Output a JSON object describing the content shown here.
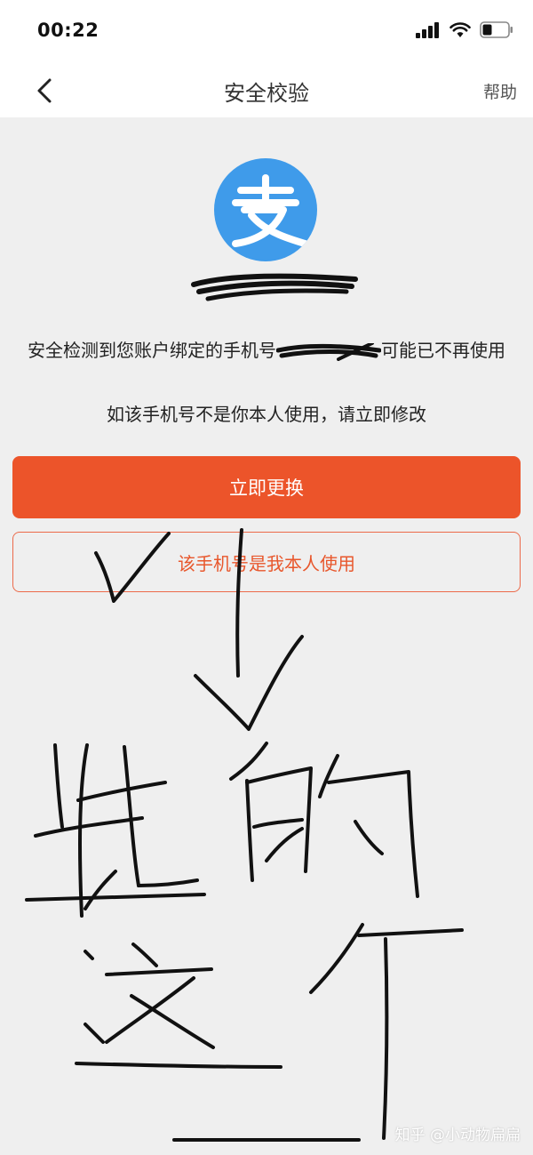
{
  "status_bar": {
    "time": "00:22"
  },
  "nav": {
    "title": "安全校验",
    "help": "帮助"
  },
  "content": {
    "warning_before": "安全检测到您账户绑定的手机号",
    "warning_after": "可能已不再使用",
    "warning_line2": "如该手机号不是你本人使用，请立即修改",
    "primary_button": "立即更换",
    "secondary_button": "该手机号是我本人使用"
  },
  "watermark": "知乎 @小动物扁扁",
  "colors": {
    "primary": "#ec542a",
    "logo_blue": "#3f9bea",
    "background": "#efefef"
  },
  "icons": {
    "back": "chevron-left-icon",
    "signal": "signal-icon",
    "wifi": "wifi-icon",
    "battery": "battery-icon",
    "logo": "alipay-logo-icon"
  }
}
